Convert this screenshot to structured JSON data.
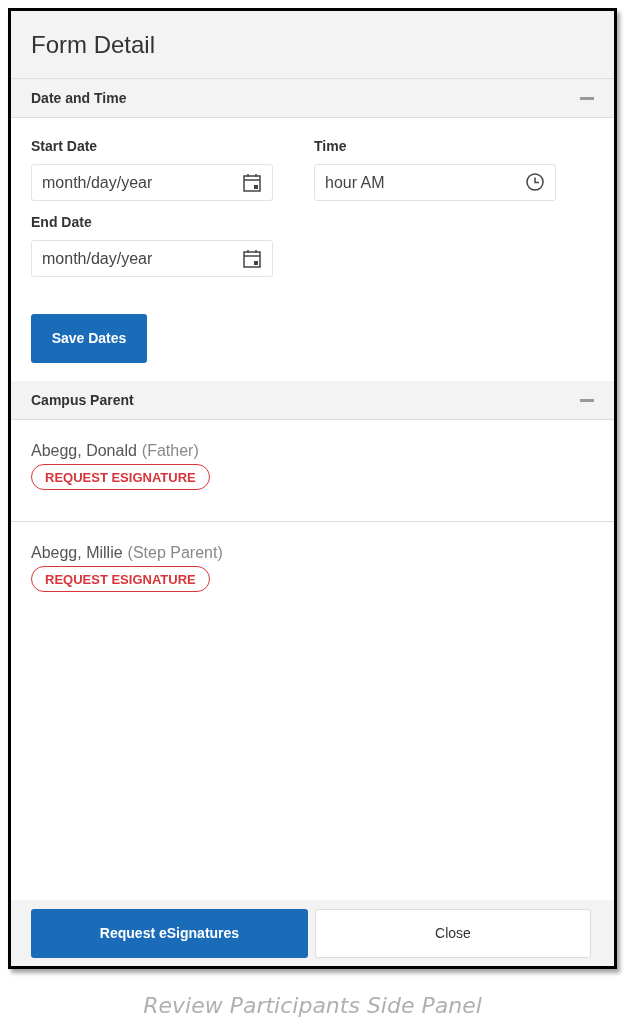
{
  "panel": {
    "title": "Form Detail"
  },
  "date_section": {
    "title": "Date and Time",
    "expanded": true,
    "fields": [
      {
        "label": "Start Date",
        "placeholder": "month/day/year",
        "kind": "date"
      },
      {
        "label": "Time",
        "placeholder": "hour AM",
        "kind": "time"
      },
      {
        "label": "End Date",
        "placeholder": "month/day/year",
        "kind": "date"
      }
    ],
    "save_button": "Save Dates"
  },
  "parent_section": {
    "title": "Campus Parent",
    "expanded": true,
    "participants": [
      {
        "name": "Abegg, Donald",
        "relation": "(Father)",
        "action": "REQUEST ESIGNATURE"
      },
      {
        "name": "Abegg, Millie",
        "relation": "(Step Parent)",
        "action": "REQUEST ESIGNATURE"
      }
    ]
  },
  "footer": {
    "primary_button": "Request eSignatures",
    "close_button": "Close"
  },
  "caption": "Review Participants Side Panel"
}
